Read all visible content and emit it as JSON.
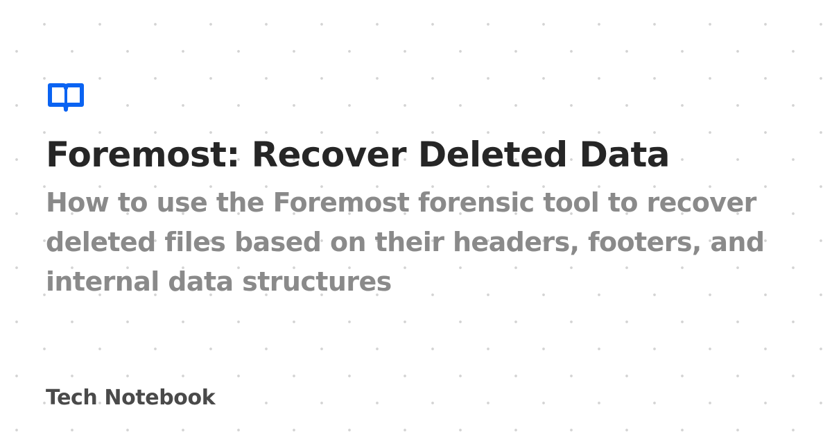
{
  "logo": {
    "icon": "open-book-icon",
    "color": "#0a63f2"
  },
  "title": "Foremost: Recover Deleted Data",
  "subtitle": "How to use the Foremost forensic tool to recover deleted files based on their headers, footers, and internal data structures",
  "site_name": "Tech Notebook",
  "colors": {
    "background": "#ffffff",
    "title": "#262626",
    "subtitle": "#8a8a8a",
    "site_name": "#4a4a4a",
    "pattern": "#cfcfcf"
  }
}
